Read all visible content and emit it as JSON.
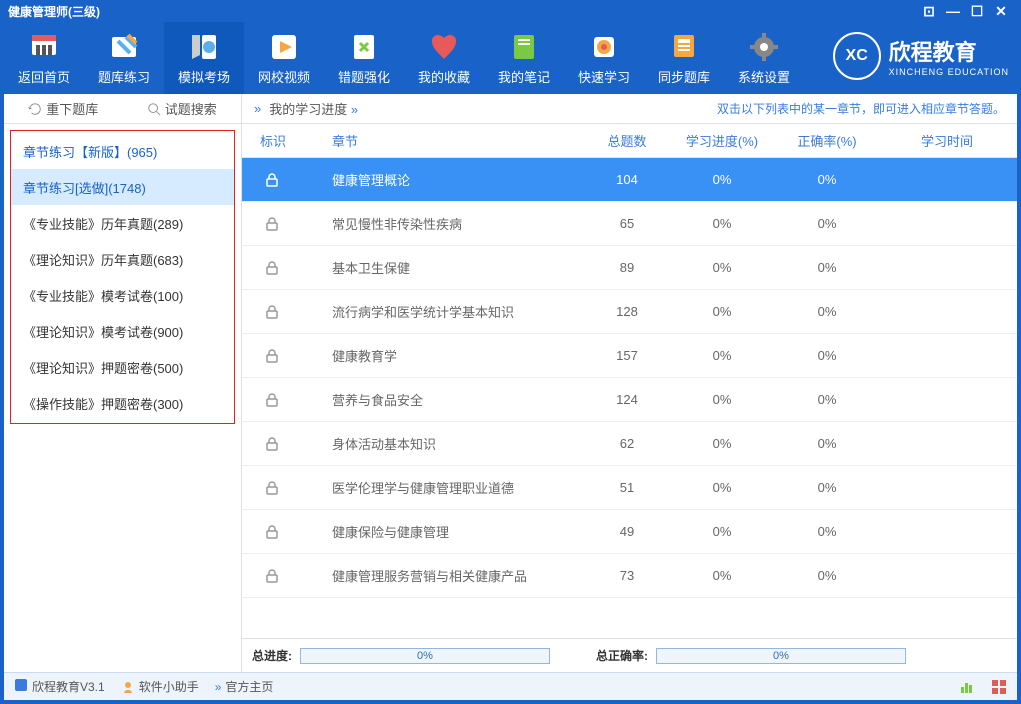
{
  "window": {
    "title": "健康管理师(三级)",
    "buttons": [
      "⊡",
      "—",
      "☐",
      "✕"
    ]
  },
  "toolbar": {
    "items": [
      {
        "label": "返回首页",
        "icon": "home"
      },
      {
        "label": "题库练习",
        "icon": "practice"
      },
      {
        "label": "模拟考场",
        "icon": "exam",
        "active": true
      },
      {
        "label": "网校视频",
        "icon": "video"
      },
      {
        "label": "错题强化",
        "icon": "wrong"
      },
      {
        "label": "我的收藏",
        "icon": "fav"
      },
      {
        "label": "我的笔记",
        "icon": "note"
      },
      {
        "label": "快速学习",
        "icon": "quick"
      },
      {
        "label": "同步题库",
        "icon": "sync"
      },
      {
        "label": "系统设置",
        "icon": "settings"
      }
    ]
  },
  "brand": {
    "code": "XC",
    "name": "欣程教育",
    "sub": "XINCHENG EDUCATION"
  },
  "leftTools": {
    "reload": "重下题库",
    "search": "试题搜索"
  },
  "rightTools": {
    "progress": "我的学习进度",
    "hint": "双击以下列表中的某一章节，即可进入相应章节答题。"
  },
  "sidebar": [
    "章节练习【新版】(965)",
    "章节练习[选做](1748)",
    "《专业技能》历年真题(289)",
    "《理论知识》历年真题(683)",
    "《专业技能》模考试卷(100)",
    "《理论知识》模考试卷(900)",
    "《理论知识》押题密卷(500)",
    "《操作技能》押题密卷(300)"
  ],
  "columns": {
    "mark": "标识",
    "chapter": "章节",
    "total": "总题数",
    "progress": "学习进度(%)",
    "correct": "正确率(%)",
    "time": "学习时间"
  },
  "rows": [
    {
      "name": "健康管理概论",
      "total": 104,
      "progress": "0%",
      "correct": "0%"
    },
    {
      "name": "常见慢性非传染性疾病",
      "total": 65,
      "progress": "0%",
      "correct": "0%"
    },
    {
      "name": "基本卫生保健",
      "total": 89,
      "progress": "0%",
      "correct": "0%"
    },
    {
      "name": "流行病学和医学统计学基本知识",
      "total": 128,
      "progress": "0%",
      "correct": "0%"
    },
    {
      "name": "健康教育学",
      "total": 157,
      "progress": "0%",
      "correct": "0%"
    },
    {
      "name": "营养与食品安全",
      "total": 124,
      "progress": "0%",
      "correct": "0%"
    },
    {
      "name": "身体活动基本知识",
      "total": 62,
      "progress": "0%",
      "correct": "0%"
    },
    {
      "name": "医学伦理学与健康管理职业道德",
      "total": 51,
      "progress": "0%",
      "correct": "0%"
    },
    {
      "name": "健康保险与健康管理",
      "total": 49,
      "progress": "0%",
      "correct": "0%"
    },
    {
      "name": "健康管理服务营销与相关健康产品",
      "total": 73,
      "progress": "0%",
      "correct": "0%"
    }
  ],
  "summary": {
    "totalProgLabel": "总进度:",
    "totalProg": "0%",
    "totalCorrectLabel": "总正确率:",
    "totalCorrect": "0%"
  },
  "status": {
    "app": "欣程教育V3.1",
    "helper": "软件小助手",
    "home": "官方主页"
  }
}
